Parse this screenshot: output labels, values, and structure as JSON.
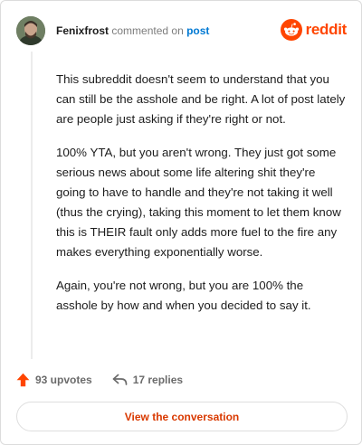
{
  "header": {
    "author": "Fenixfrost",
    "action_text": "commented on",
    "post_link": "post",
    "brand_name": "reddit"
  },
  "comment": {
    "paragraphs": [
      "This subreddit doesn't seem to understand that you can still be the asshole and be right. A lot of post lately are people just asking if they're right or not.",
      "100% YTA, but you aren't wrong. They just got some serious news about some life altering shit they're going to have to handle and they're not taking it well (thus the crying), taking this moment to let them know this is THEIR fault only adds more fuel to the fire any makes everything exponentially worse.",
      "Again, you're not wrong, but you are 100% the asshole by how and when you decided to say it."
    ]
  },
  "actions": {
    "upvotes": "93 upvotes",
    "replies": "17 replies"
  },
  "cta": {
    "label": "View the conversation"
  },
  "colors": {
    "brand": "#ff4500",
    "link": "#0079d3",
    "cta_text": "#d93900",
    "muted": "#7c7c7c"
  },
  "icons": {
    "brand": "reddit-snoo-icon",
    "upvote": "upvote-arrow-icon",
    "reply": "reply-arrow-icon"
  }
}
